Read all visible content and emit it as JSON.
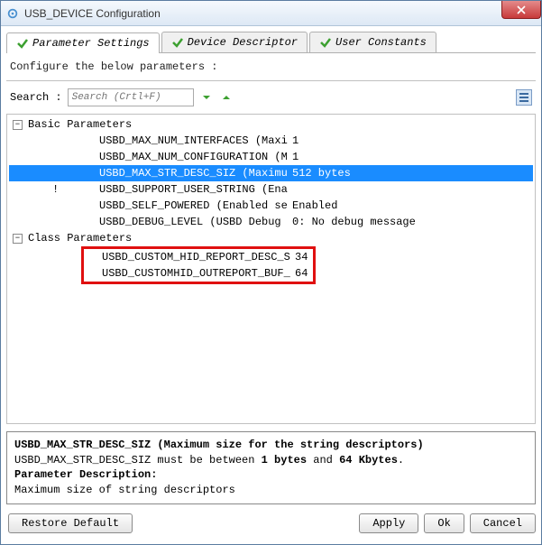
{
  "window": {
    "title": "USB_DEVICE Configuration"
  },
  "tabs": {
    "t1": "Parameter Settings",
    "t2": "Device Descriptor",
    "t3": "User Constants"
  },
  "config_note": "Configure the below parameters :",
  "search": {
    "label": "Search :",
    "placeholder": "Search (Crtl+F)"
  },
  "groups": {
    "basic": {
      "label": "Basic Parameters",
      "rows": [
        {
          "key": "USBD_MAX_NUM_INTERFACES (Maxi...",
          "val": "1"
        },
        {
          "key": "USBD_MAX_NUM_CONFIGURATION (M...",
          "val": "1"
        },
        {
          "key": "USBD_MAX_STR_DESC_SIZ (Maximu...",
          "val": "512 bytes"
        },
        {
          "key": "USBD_SUPPORT_USER_STRING (Ena...",
          "val": ""
        },
        {
          "key": "USBD_SELF_POWERED (Enabled se...",
          "val": "Enabled"
        },
        {
          "key": "USBD_DEBUG_LEVEL (USBD Debug ...",
          "val": "0: No debug message"
        }
      ]
    },
    "class": {
      "label": "Class Parameters",
      "rows": [
        {
          "key": "USBD_CUSTOM_HID_REPORT_DESC_S...",
          "val": "34"
        },
        {
          "key": "USBD_CUSTOMHID_OUTREPORT_BUF_...",
          "val": "64"
        }
      ]
    }
  },
  "desc": {
    "title": "USBD_MAX_STR_DESC_SIZ (Maximum size for the string descriptors)",
    "line1a": "USBD_MAX_STR_DESC_SIZ must be between ",
    "line1b": "1 bytes",
    "line1c": " and ",
    "line1d": "64 Kbytes",
    "line1e": ".",
    "pd": "Parameter Description:",
    "line2": "Maximum size of string descriptors"
  },
  "buttons": {
    "restore": "Restore Default",
    "apply": "Apply",
    "ok": "Ok",
    "cancel": "Cancel"
  }
}
